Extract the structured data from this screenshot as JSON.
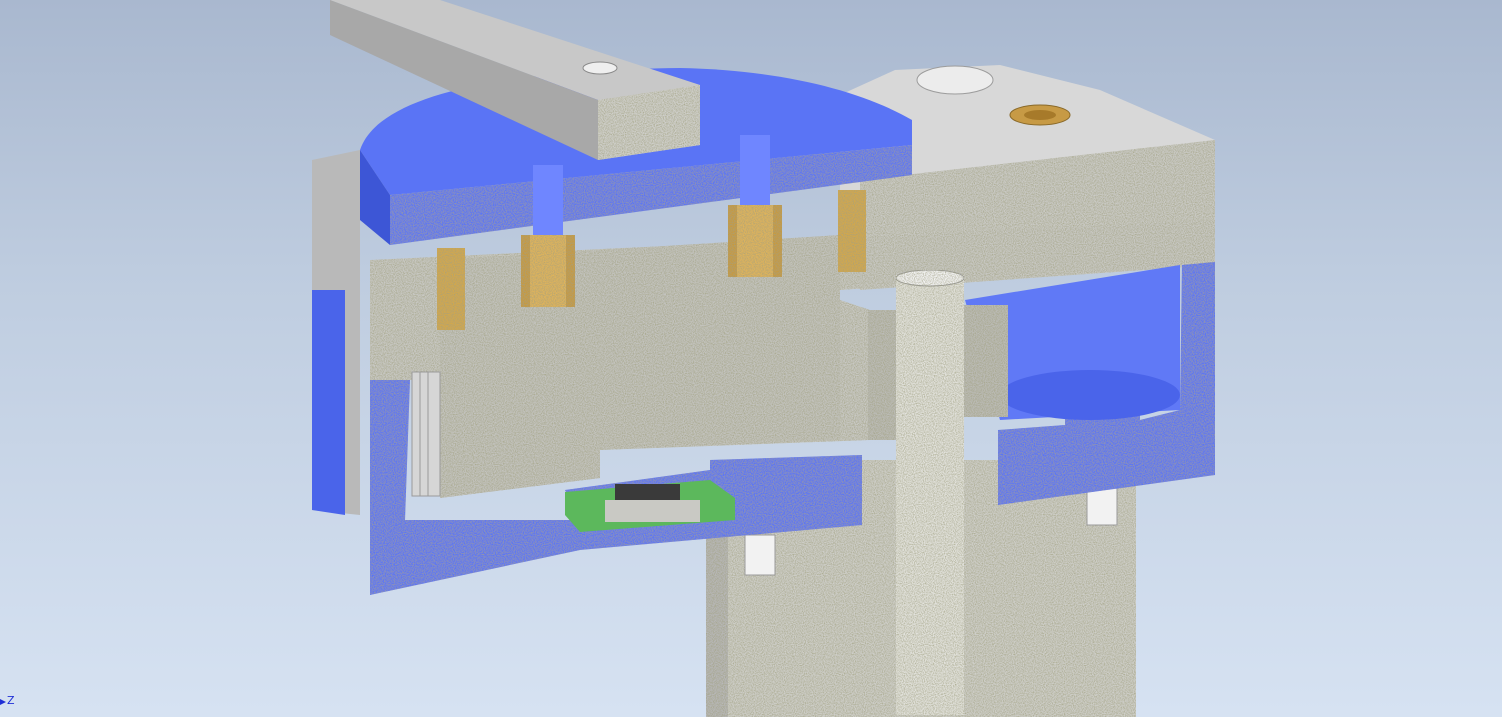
{
  "viewport": {
    "background_top": "#a9b8cf",
    "background_bottom": "#d6e2f2"
  },
  "materials": {
    "section_grey": "#c9c9c4",
    "section_blue": "#5a74f5",
    "brass": "#d4a84a",
    "pcb_green": "#5cb85c",
    "chip_dark": "#3a3a3a"
  },
  "triad": {
    "axis_label": "Z",
    "icon": "coordinate-triad-icon"
  }
}
